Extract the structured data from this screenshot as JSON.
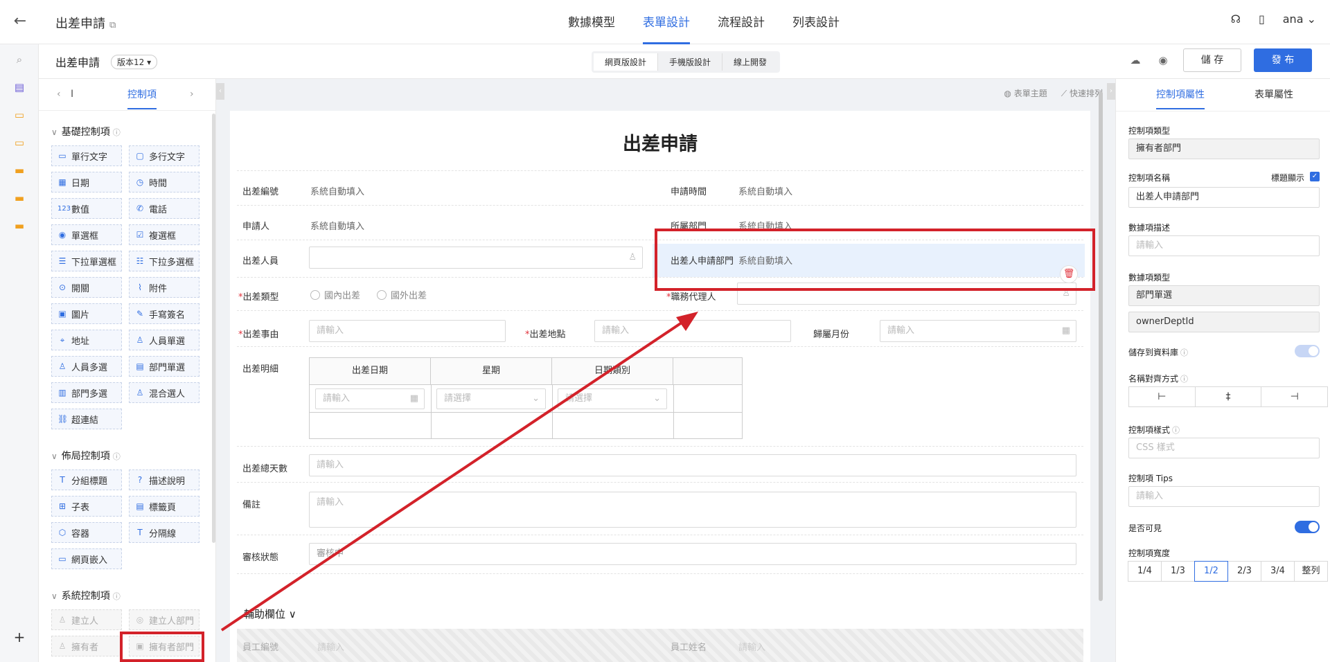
{
  "header": {
    "title": "出差申請",
    "nav_tabs": [
      {
        "label": "數據模型"
      },
      {
        "label": "表單設計",
        "active": true
      },
      {
        "label": "流程設計"
      },
      {
        "label": "列表設計"
      }
    ],
    "user": "ana"
  },
  "toolbar": {
    "form_name": "出差申請",
    "version": "版本12",
    "modes": [
      "網頁版設計",
      "手機版設計",
      "線上開發"
    ],
    "save_label": "儲 存",
    "publish_label": "發 布"
  },
  "left_panel": {
    "tab_label": "控制項",
    "truncated_label": "I",
    "sections": {
      "basic": "基礎控制項",
      "layout": "佈局控制項",
      "system": "系統控制項"
    },
    "basic_controls": [
      "單行文字",
      "多行文字",
      "日期",
      "時間",
      "數值",
      "電話",
      "單選框",
      "複選框",
      "下拉單選框",
      "下拉多選框",
      "開關",
      "附件",
      "圖片",
      "手寫簽名",
      "地址",
      "人員單選",
      "人員多選",
      "部門單選",
      "部門多選",
      "混合選人",
      "超連結"
    ],
    "layout_controls": [
      "分組標題",
      "描述說明",
      "子表",
      "標籤頁",
      "容器",
      "分隔線",
      "網頁嵌入"
    ],
    "system_controls": [
      "建立人",
      "建立人部門",
      "擁有者",
      "擁有者部門"
    ]
  },
  "canvas": {
    "actions": [
      "表單主題",
      "快速排列"
    ],
    "form_title": "出差申請",
    "fields": {
      "trip_no": {
        "label": "出差編號",
        "value": "系統自動填入"
      },
      "apply_time": {
        "label": "申請時間",
        "value": "系統自動填入"
      },
      "applicant": {
        "label": "申請人",
        "value": "系統自動填入"
      },
      "dept": {
        "label": "所屬部門",
        "value": "系統自動填入"
      },
      "traveler": {
        "label": "出差人員"
      },
      "traveler_dept": {
        "label": "出差人申請部門",
        "value": "系統自動填入"
      },
      "trip_type": {
        "label": "出差類型",
        "options": [
          "國內出差",
          "國外出差"
        ]
      },
      "agent": {
        "label": "職務代理人"
      },
      "reason": {
        "label": "出差事由",
        "placeholder": "請輸入"
      },
      "location": {
        "label": "出差地點",
        "placeholder": "請輸入"
      },
      "month": {
        "label": "歸屬月份",
        "placeholder": "請輸入"
      },
      "detail": {
        "label": "出差明細",
        "columns": [
          "出差日期",
          "星期",
          "日期類別"
        ],
        "row": {
          "date": "請輸入",
          "weekday": "請選擇",
          "category": "請選擇"
        }
      },
      "total_days": {
        "label": "出差總天數",
        "placeholder": "請輸入"
      },
      "remark": {
        "label": "備註",
        "placeholder": "請輸入"
      },
      "review": {
        "label": "審核狀態",
        "value": "審核中"
      }
    },
    "aux": {
      "title": "輔助欄位",
      "fields": [
        {
          "label": "員工編號",
          "value": "請輸入"
        },
        {
          "label": "員工姓名",
          "value": "請輸入"
        }
      ]
    }
  },
  "right_panel": {
    "tabs": [
      "控制項屬性",
      "表單屬性"
    ],
    "control_type": {
      "label": "控制項類型",
      "value": "擁有者部門"
    },
    "control_name": {
      "label": "控制項名稱",
      "value": "出差人申請部門",
      "show_title_label": "標題顯示"
    },
    "desc": {
      "label": "數據項描述",
      "placeholder": "請輸入"
    },
    "data_type": {
      "label": "數據項類型",
      "value": "部門單選",
      "field_id": "ownerDeptId"
    },
    "store": {
      "label": "儲存到資料庫"
    },
    "align": {
      "label": "名稱對齊方式"
    },
    "style": {
      "label": "控制項樣式",
      "placeholder": "CSS 樣式"
    },
    "tips": {
      "label": "控制項 Tips",
      "placeholder": "請輸入"
    },
    "visible": {
      "label": "是否可見"
    },
    "width": {
      "label": "控制項寬度",
      "options": [
        "1/4",
        "1/3",
        "1/2",
        "2/3",
        "3/4",
        "整列"
      ],
      "selected": "1/2"
    }
  },
  "colors": {
    "accent": "#2f6de1",
    "annotation": "#d3222a"
  }
}
